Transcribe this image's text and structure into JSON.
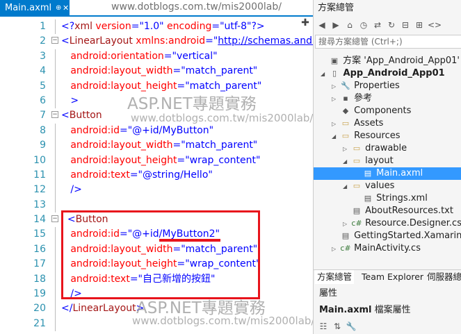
{
  "editor": {
    "tab_label": "Main.axml",
    "tab_pin": "⊕",
    "tab_close": "✕",
    "tab_watermark": "www.dotblogs.com.tw/mis2000lab/",
    "scroll_up": "✚",
    "watermarks": [
      "ASP.NET專題實務",
      "www.dotblogs.com.tw/mis2000lab/",
      "ASP.NET專題實務",
      "www.dotblogs.com.tw/mis2000lab/"
    ],
    "lines": [
      {
        "n": "1",
        "fold": "",
        "parts": [
          [
            "val",
            "<?"
          ],
          [
            "tag",
            "xml"
          ],
          [
            "attr",
            " version"
          ],
          [
            "val",
            "=\"1.0\""
          ],
          [
            "attr",
            " encoding"
          ],
          [
            "val",
            "=\"utf-8\"?>"
          ]
        ]
      },
      {
        "n": "2",
        "fold": "−",
        "parts": [
          [
            "val",
            "<"
          ],
          [
            "tag",
            "LinearLayout"
          ],
          [
            "attr",
            " xmlns:android"
          ],
          [
            "val",
            "=\""
          ],
          [
            "link",
            "http://schemas.andr"
          ]
        ]
      },
      {
        "n": "3",
        "fold": "",
        "parts": [
          [
            "attr",
            "   android:orientation"
          ],
          [
            "val",
            "=\"vertical\""
          ]
        ]
      },
      {
        "n": "4",
        "fold": "",
        "parts": [
          [
            "attr",
            "   android:layout_width"
          ],
          [
            "val",
            "=\"match_parent\""
          ]
        ]
      },
      {
        "n": "5",
        "fold": "",
        "parts": [
          [
            "attr",
            "   android:layout_height"
          ],
          [
            "val",
            "=\"match_parent\""
          ]
        ]
      },
      {
        "n": "6",
        "fold": "",
        "parts": [
          [
            "val",
            "   >"
          ]
        ]
      },
      {
        "n": "7",
        "fold": "−",
        "parts": [
          [
            "val",
            "<"
          ],
          [
            "tag",
            "Button"
          ]
        ]
      },
      {
        "n": "8",
        "fold": "",
        "parts": [
          [
            "attr",
            "   android:id"
          ],
          [
            "val",
            "=\"@+id/MyButton\""
          ]
        ]
      },
      {
        "n": "9",
        "fold": "",
        "parts": [
          [
            "attr",
            "   android:layout_width"
          ],
          [
            "val",
            "=\"match_parent\""
          ]
        ]
      },
      {
        "n": "10",
        "fold": "",
        "parts": [
          [
            "attr",
            "   android:layout_height"
          ],
          [
            "val",
            "=\"wrap_content\""
          ]
        ]
      },
      {
        "n": "11",
        "fold": "",
        "parts": [
          [
            "attr",
            "   android:text"
          ],
          [
            "val",
            "=\"@string/Hello\""
          ]
        ]
      },
      {
        "n": "12",
        "fold": "",
        "parts": [
          [
            "val",
            "   />"
          ]
        ]
      },
      {
        "n": "13",
        "fold": "",
        "parts": []
      },
      {
        "n": "14",
        "fold": "−",
        "parts": [
          [
            "val",
            "  <"
          ],
          [
            "tag",
            "Button"
          ]
        ]
      },
      {
        "n": "15",
        "fold": "",
        "parts": [
          [
            "attr",
            "   android:id"
          ],
          [
            "val",
            "=\"@+id/MyButton2\""
          ]
        ]
      },
      {
        "n": "16",
        "fold": "",
        "parts": [
          [
            "attr",
            "   android:layout_width"
          ],
          [
            "val",
            "=\"match_parent\""
          ]
        ]
      },
      {
        "n": "17",
        "fold": "",
        "parts": [
          [
            "attr",
            "   android:layout_height"
          ],
          [
            "val",
            "=\"wrap_content\""
          ]
        ]
      },
      {
        "n": "18",
        "fold": "",
        "parts": [
          [
            "attr",
            "   android:text"
          ],
          [
            "val",
            "=\"自己新增的按鈕\""
          ]
        ]
      },
      {
        "n": "19",
        "fold": "",
        "parts": [
          [
            "val",
            "   />"
          ]
        ]
      },
      {
        "n": "20",
        "fold": "",
        "parts": [
          [
            "val",
            "</"
          ],
          [
            "tag",
            "LinearLayout"
          ],
          [
            "val",
            ">"
          ]
        ]
      },
      {
        "n": "21",
        "fold": "",
        "parts": []
      }
    ]
  },
  "solution_explorer": {
    "title": "方案總管",
    "search_placeholder": "搜尋方案總管 (Ctrl+;)",
    "toolbar_icons": [
      "back-icon",
      "forward-icon",
      "home-icon",
      "history-icon",
      "sync-icon",
      "refresh-icon",
      "collapse-icon",
      "show-all-icon",
      "code-icon"
    ],
    "toolbar_glyphs": [
      "◀",
      "▶",
      "⌂",
      "◷",
      "⇄",
      "↻",
      "⊟",
      "⊞",
      "<>"
    ],
    "tree": [
      {
        "label": "方案 'App_Android_App01' (1",
        "depth": 0,
        "arrow": "",
        "icon": "▣",
        "bold": false
      },
      {
        "label": "App_Android_App01",
        "depth": 0,
        "arrow": "◢",
        "icon": "▯",
        "bold": true
      },
      {
        "label": "Properties",
        "depth": 1,
        "arrow": "▷",
        "icon": "🔧",
        "bold": false
      },
      {
        "label": "參考",
        "depth": 1,
        "arrow": "▷",
        "icon": "▪",
        "bold": false
      },
      {
        "label": "Components",
        "depth": 1,
        "arrow": "",
        "icon": "◆",
        "bold": false
      },
      {
        "label": "Assets",
        "depth": 1,
        "arrow": "▷",
        "icon": "▭",
        "bold": false
      },
      {
        "label": "Resources",
        "depth": 1,
        "arrow": "◢",
        "icon": "▭",
        "bold": false
      },
      {
        "label": "drawable",
        "depth": 2,
        "arrow": "▷",
        "icon": "▭",
        "bold": false
      },
      {
        "label": "layout",
        "depth": 2,
        "arrow": "◢",
        "icon": "▭",
        "bold": false
      },
      {
        "label": "Main.axml",
        "depth": 3,
        "arrow": "",
        "icon": "▤",
        "bold": false,
        "selected": true
      },
      {
        "label": "values",
        "depth": 2,
        "arrow": "◢",
        "icon": "▭",
        "bold": false
      },
      {
        "label": "Strings.xml",
        "depth": 3,
        "arrow": "",
        "icon": "▤",
        "bold": false
      },
      {
        "label": "AboutResources.txt",
        "depth": 2,
        "arrow": "",
        "icon": "▤",
        "bold": false
      },
      {
        "label": "Resource.Designer.cs",
        "depth": 2,
        "arrow": "▷",
        "icon": "c#",
        "bold": false
      },
      {
        "label": "GettingStarted.Xamarin",
        "depth": 1,
        "arrow": "",
        "icon": "▤",
        "bold": false
      },
      {
        "label": "MainActivity.cs",
        "depth": 1,
        "arrow": "▷",
        "icon": "c#",
        "bold": false
      }
    ],
    "bottom_tabs": [
      "方案總管",
      "Team Explorer",
      "伺服器總"
    ]
  },
  "properties": {
    "title": "屬性",
    "subject": "Main.axml",
    "subject_suffix": " 檔案屬性",
    "toolbar_glyphs": [
      "☷",
      "⇅",
      "🔧"
    ]
  }
}
